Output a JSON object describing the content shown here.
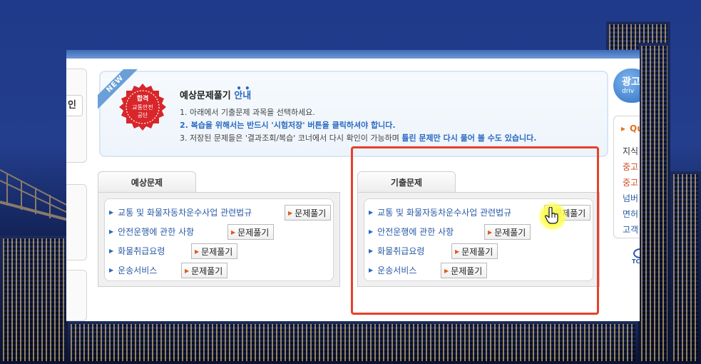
{
  "intro": {
    "badge": "NEW",
    "seal_lines": [
      "합격",
      "교통안전",
      "공단"
    ],
    "title_main": "예상문제풀기 ",
    "title_highlight": "안내",
    "line1": "1. 아래에서 기출문제 과목을 선택하세요.",
    "line2": "2. 복습을 위해서는 반드시 '시험저장' 버튼을 클릭하셔야 합니다.",
    "line3_prefix": "3. 저장된 문제들은 '결과조회/복습' 코너에서 다시 확인이 가능하며 ",
    "line3_emph": "틀린 문제만 다시 풀어 볼 수도 있습니다."
  },
  "left_fragment": {
    "button_text": "인"
  },
  "panels": [
    {
      "tab": "예상문제",
      "button_label": "문제풀기",
      "items": [
        "교통 및 화물자동차운수사업 관련법규",
        "안전운행에 관한 사항",
        "화물취급요령",
        "운송서비스"
      ]
    },
    {
      "tab": "기출문제",
      "button_label": "문제풀기",
      "items": [
        "교통 및 화물자동차운수사업 관련법규",
        "안전운행에 관한 사항",
        "화물취급요령",
        "운송서비스"
      ]
    }
  ],
  "right_sidebar": {
    "ad_text": "광고",
    "ad_sub": "driv",
    "quick_header": "Qu",
    "items": [
      {
        "text": "지식",
        "color": "#333333"
      },
      {
        "text": "중고",
        "color": "#d24a1a"
      },
      {
        "text": "중고",
        "color": "#d24a1a"
      },
      {
        "text": "넘버",
        "color": "#2a5aa6"
      },
      {
        "text": "면허",
        "color": "#2a5aa6"
      },
      {
        "text": "고객",
        "color": "#2a5aa6"
      }
    ],
    "logo_text": "TC"
  },
  "colors": {
    "accent_blue": "#2a6ac0",
    "highlight_red": "#e8402a",
    "seal_red": "#d8262b"
  }
}
